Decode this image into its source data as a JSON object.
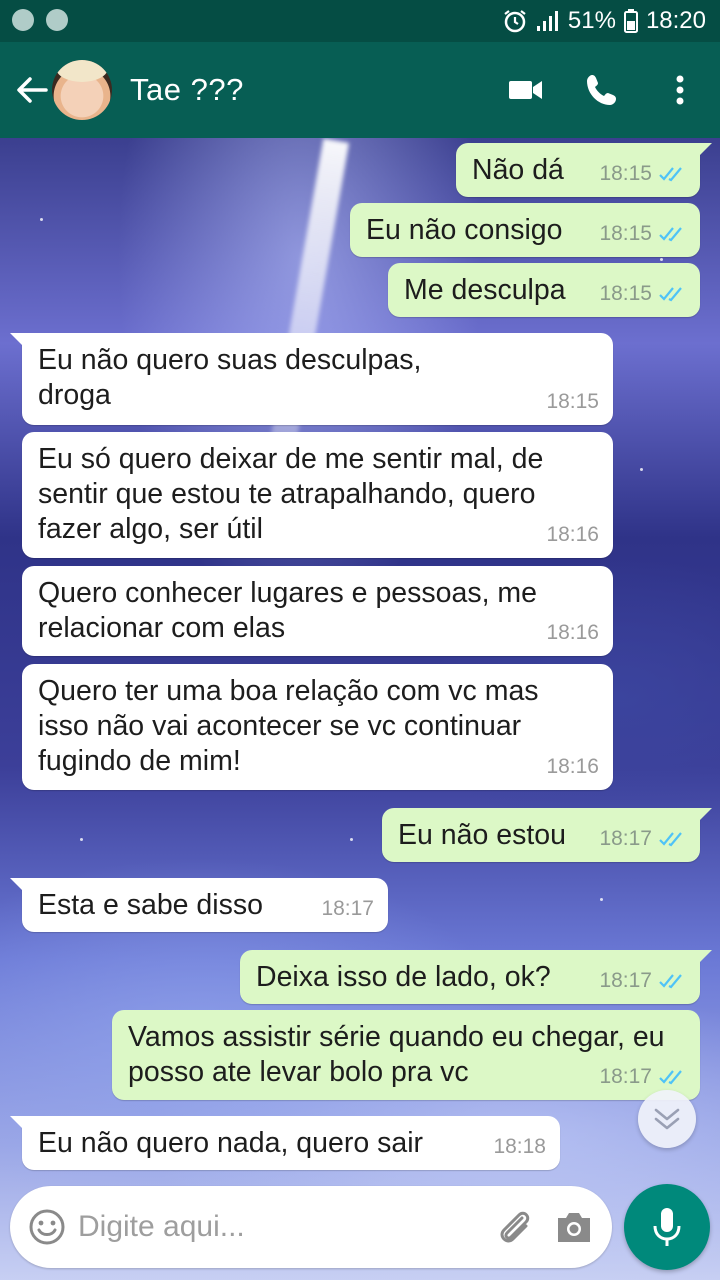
{
  "status_bar": {
    "battery": "51%",
    "time": "18:20"
  },
  "header": {
    "contact_name": "Tae ???"
  },
  "colors": {
    "header": "#075e54",
    "status_bar": "#054d44",
    "outgoing": "#dcf8c6",
    "incoming": "#ffffff",
    "read_ticks": "#4fc3f7",
    "mic_button": "#00897b"
  },
  "messages": [
    {
      "dir": "out",
      "text": "Não dá",
      "time": "18:15",
      "read": true
    },
    {
      "dir": "out",
      "text": "Eu não consigo",
      "time": "18:15",
      "read": true
    },
    {
      "dir": "out",
      "text": "Me desculpa",
      "time": "18:15",
      "read": true
    },
    {
      "dir": "in",
      "text": "Eu não quero suas desculpas, droga",
      "time": "18:15"
    },
    {
      "dir": "in",
      "text": "Eu só quero deixar de me sentir mal, de sentir que estou te atrapalhando, quero fazer algo, ser útil",
      "time": "18:16"
    },
    {
      "dir": "in",
      "text": "Quero conhecer lugares e pessoas, me relacionar com elas",
      "time": "18:16"
    },
    {
      "dir": "in",
      "text": "Quero ter uma boa relação com vc mas isso não vai acontecer se vc continuar fugindo de mim!",
      "time": "18:16"
    },
    {
      "dir": "out",
      "text": "Eu não estou",
      "time": "18:17",
      "read": true
    },
    {
      "dir": "in",
      "text": "Esta e sabe disso",
      "time": "18:17"
    },
    {
      "dir": "out",
      "text": "Deixa isso de lado, ok?",
      "time": "18:17",
      "read": true
    },
    {
      "dir": "out",
      "text": "Vamos assistir série quando eu chegar, eu posso ate levar bolo pra vc",
      "time": "18:17",
      "read": true
    },
    {
      "dir": "in",
      "text": "Eu não quero nada, quero sair",
      "time": "18:18"
    }
  ],
  "composer": {
    "placeholder": "Digite aqui..."
  },
  "icons": [
    "back-arrow-icon",
    "video-call-icon",
    "phone-icon",
    "more-vert-icon",
    "emoji-icon",
    "attach-icon",
    "camera-icon",
    "mic-icon",
    "chevron-down-icon",
    "double-check-icon",
    "alarm-icon",
    "signal-icon",
    "battery-icon"
  ]
}
